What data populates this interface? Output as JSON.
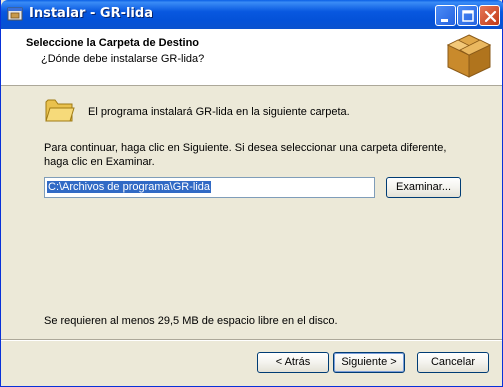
{
  "window": {
    "title": "Instalar - GR-lida"
  },
  "header": {
    "title": "Seleccione la Carpeta de Destino",
    "subtitle": "¿Dónde debe instalarse GR-lida?"
  },
  "main": {
    "folder_text": "El programa instalará GR-lida en la siguiente carpeta.",
    "instructions": "Para continuar, haga clic en Siguiente. Si desea seleccionar una carpeta diferente, haga clic en Examinar.",
    "path_value": "C:\\Archivos de programa\\GR-lida",
    "browse_label": "Examinar...",
    "space_required": "Se requieren al menos 29,5 MB de espacio libre en el disco."
  },
  "footer": {
    "back_label": "< Atrás",
    "next_label": "Siguiente >",
    "cancel_label": "Cancelar"
  },
  "colors": {
    "titlebar": "#0858e0",
    "selection": "#316ac5",
    "background": "#ece9d8"
  },
  "icons": {
    "app": "installer-icon",
    "header": "package-box-icon",
    "folder": "folder-icon",
    "minimize": "minimize-icon",
    "maximize": "maximize-icon",
    "close": "close-icon"
  }
}
